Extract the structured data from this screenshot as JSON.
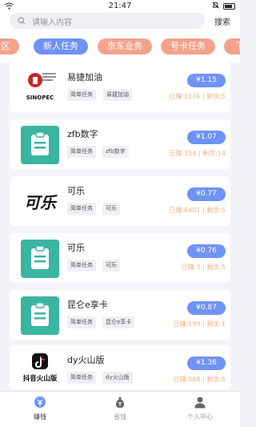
{
  "status_bar": {
    "time": "21:47"
  },
  "search": {
    "placeholder": "请输入内容",
    "button": "搜索"
  },
  "tabs": [
    {
      "label": "区"
    },
    {
      "label": "新人任务",
      "active": true
    },
    {
      "label": "京东业务"
    },
    {
      "label": "号卡任务"
    },
    {
      "label": "下"
    }
  ],
  "tasks": [
    {
      "title": "易捷加油",
      "icon": "sinopec-logo-icon",
      "tags": [
        "简单任务",
        "易捷加油"
      ],
      "price": "¥1.15",
      "earned": "已赚:3176",
      "remaining": "剩余:5"
    },
    {
      "title": "zfb数字",
      "icon": "note-icon",
      "tags": [
        "简单任务",
        "zfb数字"
      ],
      "price": "¥1.07",
      "earned": "已赚:354",
      "remaining": "剩余:14"
    },
    {
      "title": "可乐",
      "icon": "cola-logo-icon",
      "tags": [
        "简单任务",
        "可乐"
      ],
      "price": "¥0.77",
      "earned": "已赚:6401",
      "remaining": "剩余:5"
    },
    {
      "title": "可乐",
      "icon": "note-icon",
      "tags": [
        "简单任务",
        "可乐"
      ],
      "price": "¥0.76",
      "earned": "已赚:3",
      "remaining": "剩余:5"
    },
    {
      "title": "昆仑e享卡",
      "icon": "note-icon",
      "tags": [
        "简单任务",
        "昆仑e享卡"
      ],
      "price": "¥0.87",
      "earned": "已赚:199",
      "remaining": "剩余:1"
    },
    {
      "title": "dy火山版",
      "icon": "douyin-logo-icon",
      "tags": [
        "简单任务",
        "dy火山版"
      ],
      "price": "¥1.36",
      "earned": "已赚:568",
      "remaining": "剩余:5"
    }
  ],
  "logo_text": {
    "sinopec": "SINOPEC",
    "douyin": "抖音火山版",
    "cola": "可乐"
  },
  "bottom_nav": [
    {
      "label": "赚钱",
      "icon": "earn-icon",
      "active": true
    },
    {
      "label": "省钱",
      "icon": "money-bag-icon"
    },
    {
      "label": "个人中心",
      "icon": "person-icon"
    }
  ],
  "colors": {
    "accent": "#6f93f4",
    "tab_inactive": "#f3a38c",
    "teal": "#3ab5a0",
    "stats": "#e7b58a"
  }
}
